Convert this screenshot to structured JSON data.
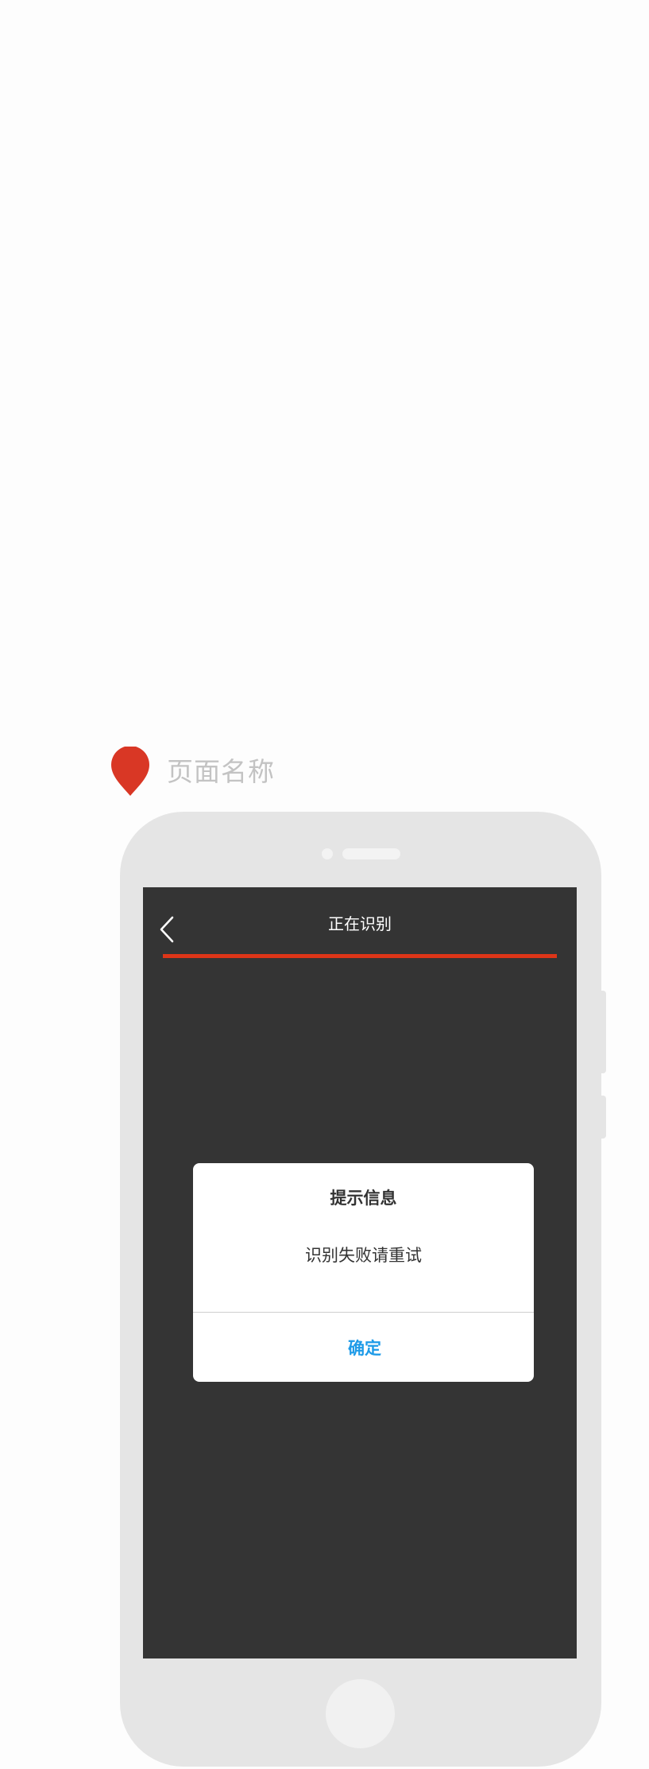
{
  "page_label": {
    "text": "页面名称",
    "icon": "map-pin-icon",
    "icon_color": "#d93725"
  },
  "nav": {
    "back_icon": "chevron-left-icon",
    "title": "正在识别"
  },
  "progress": {
    "value": 1.0,
    "color": "#dd3518"
  },
  "dialog": {
    "title": "提示信息",
    "message": "识别失败请重试",
    "confirm_label": "确定",
    "confirm_color": "#1e9be8"
  },
  "colors": {
    "screen_background": "#343434",
    "phone_frame": "#e5e5e5"
  }
}
